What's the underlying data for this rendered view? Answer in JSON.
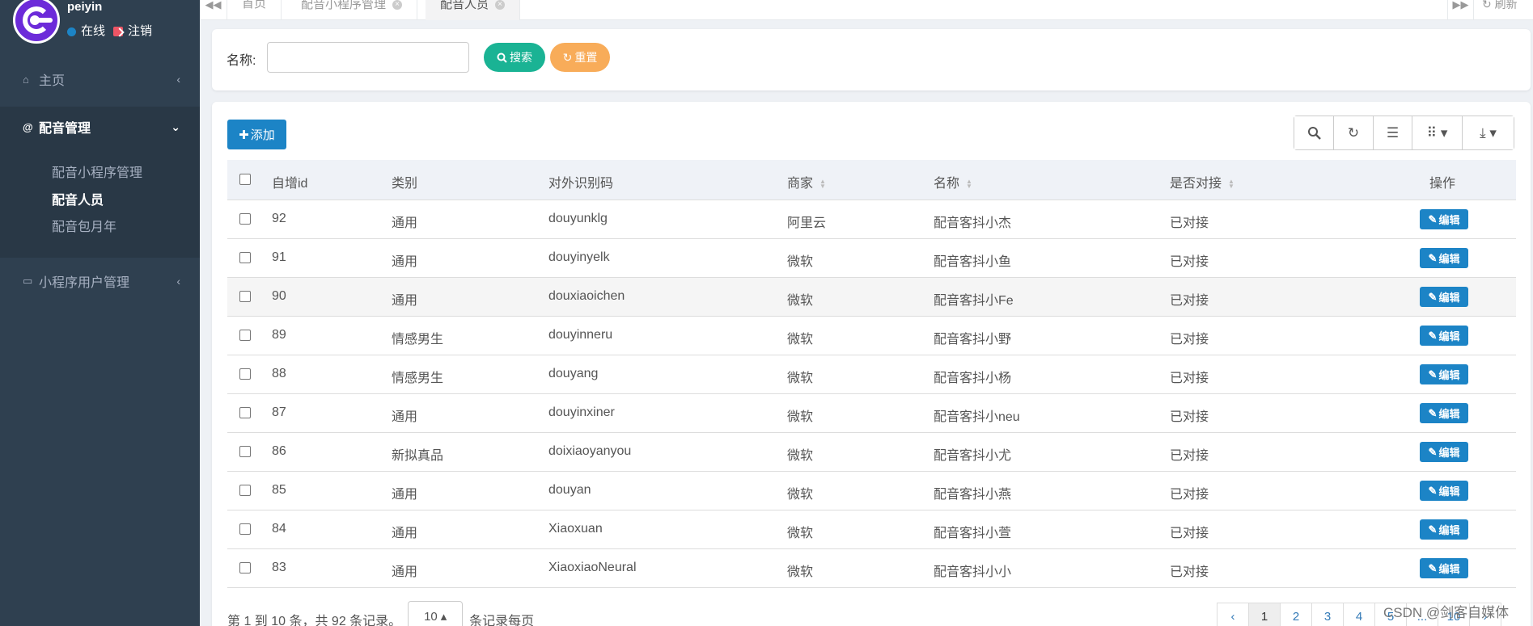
{
  "user": {
    "name": "peiyin",
    "online": "在线",
    "logout": "注销"
  },
  "sidebar": {
    "home": "主页",
    "dub_group": "配音管理",
    "sub_items": [
      "配音小程序管理",
      "配音人员",
      "配音包月年"
    ],
    "mini_users": "小程序用户管理"
  },
  "tabs": [
    {
      "label": "首页"
    },
    {
      "label": "配音小程序管理"
    },
    {
      "label": "配音人员"
    }
  ],
  "topbar": {
    "refresh": "刷新"
  },
  "search": {
    "label": "名称:",
    "value": "",
    "search_btn": "搜索",
    "reset_btn": "重置"
  },
  "table": {
    "add_btn": "添加",
    "columns": [
      "自增id",
      "类别",
      "对外识别码",
      "商家",
      "名称",
      "是否对接",
      "操作"
    ],
    "rows": [
      {
        "id": "92",
        "category": "通用",
        "code": "douyunklg",
        "merchant": "阿里云",
        "name": "配音客抖小杰",
        "docked": "已对接",
        "action": "编辑"
      },
      {
        "id": "91",
        "category": "通用",
        "code": "douyinyelk",
        "merchant": "微软",
        "name": "配音客抖小鱼",
        "docked": "已对接",
        "action": "编辑"
      },
      {
        "id": "90",
        "category": "通用",
        "code": "douxiaoichen",
        "merchant": "微软",
        "name": "配音客抖小Fe",
        "docked": "已对接",
        "action": "编辑"
      },
      {
        "id": "89",
        "category": "情感男生",
        "code": "douyinneru",
        "merchant": "微软",
        "name": "配音客抖小野",
        "docked": "已对接",
        "action": "编辑"
      },
      {
        "id": "88",
        "category": "情感男生",
        "code": "douyang",
        "merchant": "微软",
        "name": "配音客抖小杨",
        "docked": "已对接",
        "action": "编辑"
      },
      {
        "id": "87",
        "category": "通用",
        "code": "douyinxiner",
        "merchant": "微软",
        "name": "配音客抖小neu",
        "docked": "已对接",
        "action": "编辑"
      },
      {
        "id": "86",
        "category": "新拟真品",
        "code": "doixiaoyanyou",
        "merchant": "微软",
        "name": "配音客抖小尤",
        "docked": "已对接",
        "action": "编辑"
      },
      {
        "id": "85",
        "category": "通用",
        "code": "douyan",
        "merchant": "微软",
        "name": "配音客抖小燕",
        "docked": "已对接",
        "action": "编辑"
      },
      {
        "id": "84",
        "category": "通用",
        "code": "Xiaoxuan",
        "merchant": "微软",
        "name": "配音客抖小萱",
        "docked": "已对接",
        "action": "编辑"
      },
      {
        "id": "83",
        "category": "通用",
        "code": "XiaoxiaoNeural",
        "merchant": "微软",
        "name": "配音客抖小小",
        "docked": "已对接",
        "action": "编辑"
      }
    ]
  },
  "pager": {
    "info": "第 1 到 10 条，共 92 条记录。",
    "page_size": "10",
    "per_page": "条记录每页",
    "prev": "‹",
    "pages": [
      "1",
      "2",
      "3",
      "4",
      "5",
      "...",
      "10"
    ],
    "next": "›"
  },
  "watermark": "CSDN @剑客自媒体",
  "colors": {
    "sidebar": "#2f4050",
    "primary": "#1c84c6",
    "success": "#1ab394",
    "warning": "#f8ac59"
  }
}
